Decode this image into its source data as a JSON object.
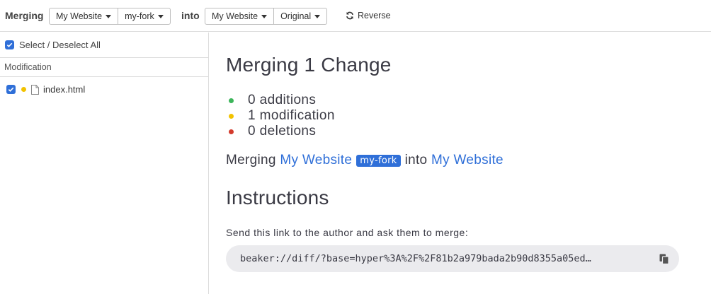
{
  "toolbar": {
    "merging_label": "Merging",
    "source_site": "My Website",
    "source_branch": "my-fork",
    "into_label": "into",
    "target_site": "My Website",
    "target_branch": "Original",
    "reverse_label": "Reverse"
  },
  "sidebar": {
    "select_all_label": "Select / Deselect All",
    "select_all_checked": true,
    "section_header": "Modification",
    "files": [
      {
        "name": "index.html",
        "checked": true,
        "status": "modification",
        "status_color": "#f2c200"
      }
    ]
  },
  "main": {
    "heading": "Merging 1 Change",
    "stats": [
      {
        "label": "0 additions",
        "color": "#3cb55a"
      },
      {
        "label": "1 modification",
        "color": "#f2c200"
      },
      {
        "label": "0 deletions",
        "color": "#d33a2c"
      }
    ],
    "merge_line": {
      "prefix": "Merging",
      "source": "My Website",
      "badge": "my-fork",
      "into": "into",
      "target": "My Website"
    },
    "instructions_heading": "Instructions",
    "instructions_text": "Send this link to the author and ask them to merge:",
    "link": "beaker://diff/?base=hyper%3A%2F%2F81b2a979bada2b90d8355a05ed…"
  },
  "colors": {
    "accent": "#2f6fd8",
    "addition": "#3cb55a",
    "modification": "#f2c200",
    "deletion": "#d33a2c"
  },
  "icons": [
    "caret-down-icon",
    "reverse-icon",
    "checkbox-icon",
    "file-icon",
    "copy-icon"
  ]
}
